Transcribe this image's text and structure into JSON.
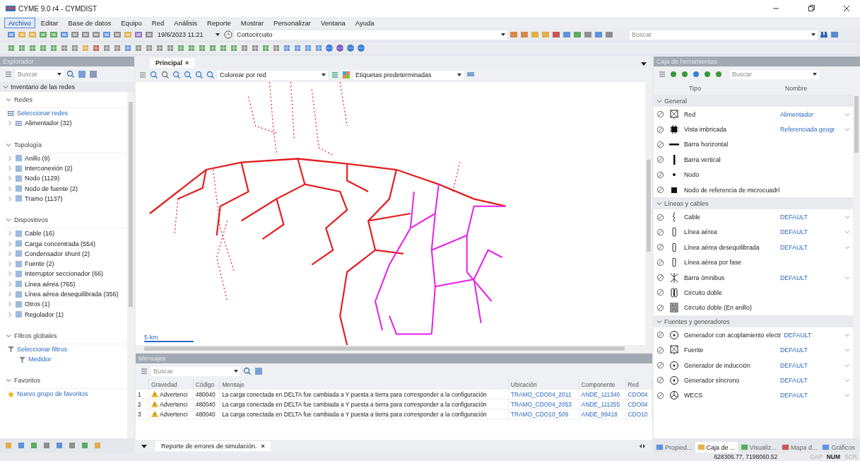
{
  "window": {
    "title": "CYME 9.0 r4 - CYMDIST"
  },
  "menu": [
    {
      "label": "Archivo",
      "selected": true
    },
    {
      "label": "Editar",
      "selected": false
    },
    {
      "label": "Base de datos",
      "selected": false
    },
    {
      "label": "Equipo",
      "selected": false
    },
    {
      "label": "Red",
      "selected": false
    },
    {
      "label": "Análisis",
      "selected": false
    },
    {
      "label": "Reporte",
      "selected": false
    },
    {
      "label": "Mostrar",
      "selected": false
    },
    {
      "label": "Personalizar",
      "selected": false
    },
    {
      "label": "Ventana",
      "selected": false
    },
    {
      "label": "Ayuda",
      "selected": false
    }
  ],
  "toolbar": {
    "date": "19/6/2023 11:21",
    "study": "Cortocircuito",
    "search_placeholder": "Buscar"
  },
  "explorer": {
    "title": "Explorador",
    "search_placeholder": "Buscar",
    "inventory": "Inventario de las redes",
    "sections": [
      {
        "title": "Redes",
        "expanded": true,
        "items": [
          {
            "label": "Seleccionar redes",
            "kind": "link"
          },
          {
            "label": "Alimentador (32)",
            "kind": "network",
            "expanded": false
          }
        ]
      },
      {
        "title": "Topología",
        "expanded": true,
        "items": [
          {
            "label": "Anillo (9)",
            "kind": "folder",
            "expanded": false
          },
          {
            "label": "Interconexión (2)",
            "kind": "folder",
            "expanded": false
          },
          {
            "label": "Nodo (1129)",
            "kind": "folder",
            "expanded": false
          },
          {
            "label": "Nodo de fuente (2)",
            "kind": "folder",
            "expanded": false
          },
          {
            "label": "Tramo (1137)",
            "kind": "folder",
            "expanded": false
          }
        ]
      },
      {
        "title": "Dispositivos",
        "expanded": true,
        "items": [
          {
            "label": "Cable (16)",
            "kind": "folder",
            "expanded": false
          },
          {
            "label": "Carga concentrada (554)",
            "kind": "folder",
            "expanded": false
          },
          {
            "label": "Condensador shunt (2)",
            "kind": "folder",
            "expanded": false
          },
          {
            "label": "Fuente (2)",
            "kind": "folder",
            "expanded": false
          },
          {
            "label": "Interruptor seccionador (66)",
            "kind": "folder",
            "expanded": false
          },
          {
            "label": "Línea aérea (765)",
            "kind": "folder",
            "expanded": false
          },
          {
            "label": "Línea aérea desequilibrada (356)",
            "kind": "folder",
            "expanded": false
          },
          {
            "label": "Otros (1)",
            "kind": "folder",
            "expanded": false
          },
          {
            "label": "Regulador (1)",
            "kind": "folder",
            "expanded": false
          }
        ]
      },
      {
        "title": "Filtros globales",
        "expanded": true,
        "items": [
          {
            "label": "Seleccionar filtros",
            "kind": "filter",
            "children": [
              {
                "label": "Medidor",
                "kind": "filter"
              }
            ]
          }
        ]
      },
      {
        "title": "Favoritos",
        "expanded": true,
        "items": [
          {
            "label": "Nuevo grupo de favoritos",
            "kind": "star"
          }
        ]
      }
    ]
  },
  "map": {
    "tab": "Principal",
    "close": "×",
    "color_by": "Colorear por red",
    "labels": "Etiquetas predeterminadas",
    "scale": "5 km"
  },
  "messages": {
    "title": "Mensajes",
    "search_placeholder": "Buscar",
    "columns": [
      "Gravedad",
      "Código",
      "Mensaje",
      "Ubicación",
      "Componente",
      "Red"
    ],
    "rows": [
      {
        "index": "1",
        "severity": "Advertenci",
        "code": "480040",
        "message": "La carga conectada en DELTA fue cambiada a Y puesta a tierra para corresponder a la configuración",
        "location": "TRAMO_CDO04_2011",
        "component": "ANDE_111340",
        "network": "CDO04"
      },
      {
        "index": "2",
        "severity": "Advertenci",
        "code": "480040",
        "message": "La carga conectada en DELTA fue cambiada a Y puesta a tierra para corresponder a la configuración",
        "location": "TRAMO_CDO04_2053",
        "component": "ANDE_111255",
        "network": "CDO04"
      },
      {
        "index": "3",
        "severity": "Advertenci",
        "code": "480040",
        "message": "La carga conectada en DELTA fue cambiada a Y puesta a tierra para corresponder a la configuración",
        "location": "TRAMO_CDO10_509",
        "component": "ANDE_99418",
        "network": "CDO10"
      }
    ],
    "tab": "Reporte de errores de simulación.",
    "tab_close": "×"
  },
  "toolbox": {
    "title": "Caja de herramientas",
    "search_placeholder": "Buscar",
    "columns": [
      "Tipo",
      "Nombre"
    ],
    "groups": [
      {
        "title": "General",
        "expanded": true,
        "items": [
          {
            "label": "Red",
            "name": "Alimentador"
          },
          {
            "label": "Vista imbricada",
            "name": "Referenciada geogr"
          },
          {
            "label": "Barra horizontal"
          },
          {
            "label": "Barra vertical"
          },
          {
            "label": "Nodo"
          },
          {
            "label": "Nodo de referencia de microcuadrí"
          }
        ]
      },
      {
        "title": "Líneas y cables",
        "expanded": true,
        "items": [
          {
            "label": "Cable",
            "name": "DEFAULT"
          },
          {
            "label": "Línea aérea",
            "name": "DEFAULT"
          },
          {
            "label": "Línea aérea desequilibrada",
            "name": "DEFAULT"
          },
          {
            "label": "Línea aérea por fase"
          },
          {
            "label": "Barra ómnibus",
            "name": "DEFAULT"
          },
          {
            "label": "Circuito doble"
          },
          {
            "label": "Circuito doble (En anillo)"
          }
        ]
      },
      {
        "title": "Fuentes y generadores",
        "expanded": true,
        "items": [
          {
            "label": "Generador con acoplamiento electr",
            "name": "DEFAULT"
          },
          {
            "label": "Fuente",
            "name": "DEFAULT"
          },
          {
            "label": "Generador de inducción",
            "name": "DEFAULT"
          },
          {
            "label": "Generador síncrono",
            "name": "DEFAULT"
          },
          {
            "label": "WECS",
            "name": "DEFAULT"
          }
        ]
      }
    ]
  },
  "panel_tabs": [
    {
      "label": "Propied...",
      "selected": false
    },
    {
      "label": "Caja de ...",
      "selected": true
    },
    {
      "label": "Visualiz...",
      "selected": false
    },
    {
      "label": "Mapa d...",
      "selected": false
    },
    {
      "label": "Gráficos",
      "selected": false
    }
  ],
  "status_bar": {
    "coordinates": "628306.77, 7198060.52",
    "indicators": [
      {
        "label": "CAP",
        "on": false
      },
      {
        "label": "NUM",
        "on": true
      },
      {
        "label": "SCR",
        "on": false
      }
    ]
  }
}
